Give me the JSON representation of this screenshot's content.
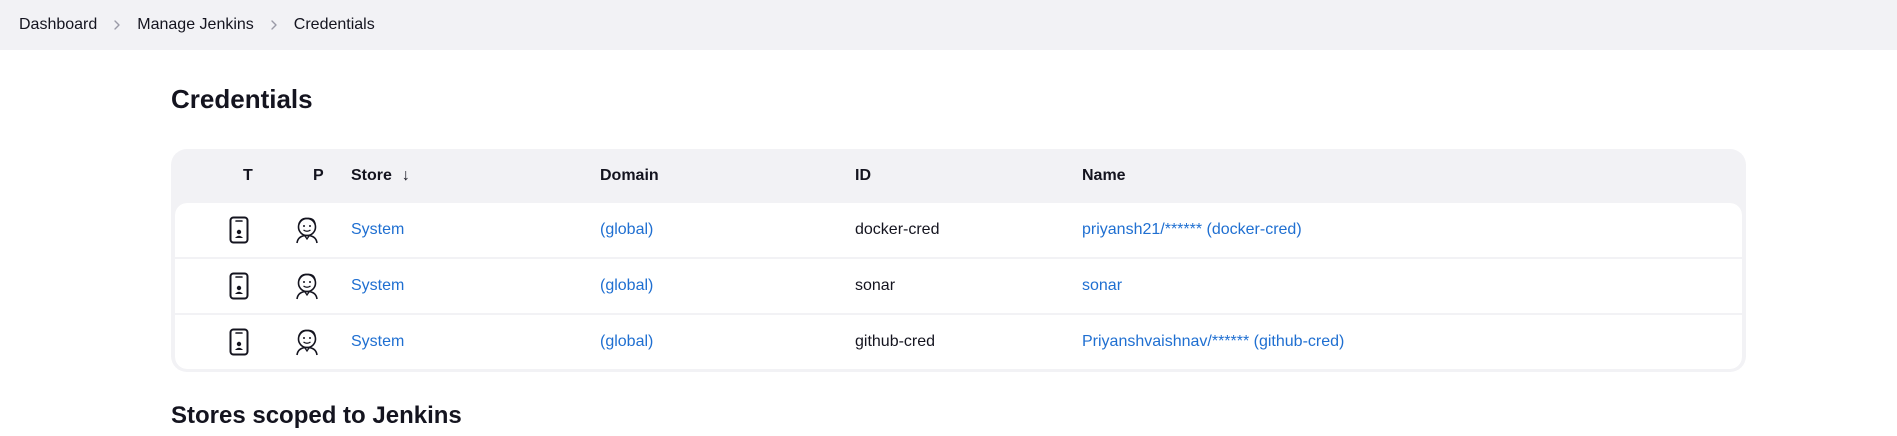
{
  "breadcrumb": {
    "items": [
      {
        "label": "Dashboard"
      },
      {
        "label": "Manage Jenkins"
      },
      {
        "label": "Credentials"
      }
    ]
  },
  "page": {
    "title": "Credentials",
    "stores_section_title": "Stores scoped to Jenkins"
  },
  "table": {
    "headers": {
      "t": "T",
      "p": "P",
      "store": "Store",
      "store_sort_indicator": "↓",
      "domain": "Domain",
      "id": "ID",
      "name": "Name"
    },
    "rows": [
      {
        "type_icon": "mobile-id-card-icon",
        "provider_icon": "jenkins-butler-icon",
        "store": "System",
        "domain": "(global)",
        "id": "docker-cred",
        "name": "priyansh21/****** (docker-cred)"
      },
      {
        "type_icon": "mobile-id-card-icon",
        "provider_icon": "jenkins-butler-icon",
        "store": "System",
        "domain": "(global)",
        "id": "sonar",
        "name": "sonar"
      },
      {
        "type_icon": "mobile-id-card-icon",
        "provider_icon": "jenkins-butler-icon",
        "store": "System",
        "domain": "(global)",
        "id": "github-cred",
        "name": "Priyanshvaishnav/****** (github-cred)"
      }
    ]
  },
  "colors": {
    "link": "#1f6fd1",
    "header_bg": "#f2f2f5",
    "text": "#14141f"
  }
}
